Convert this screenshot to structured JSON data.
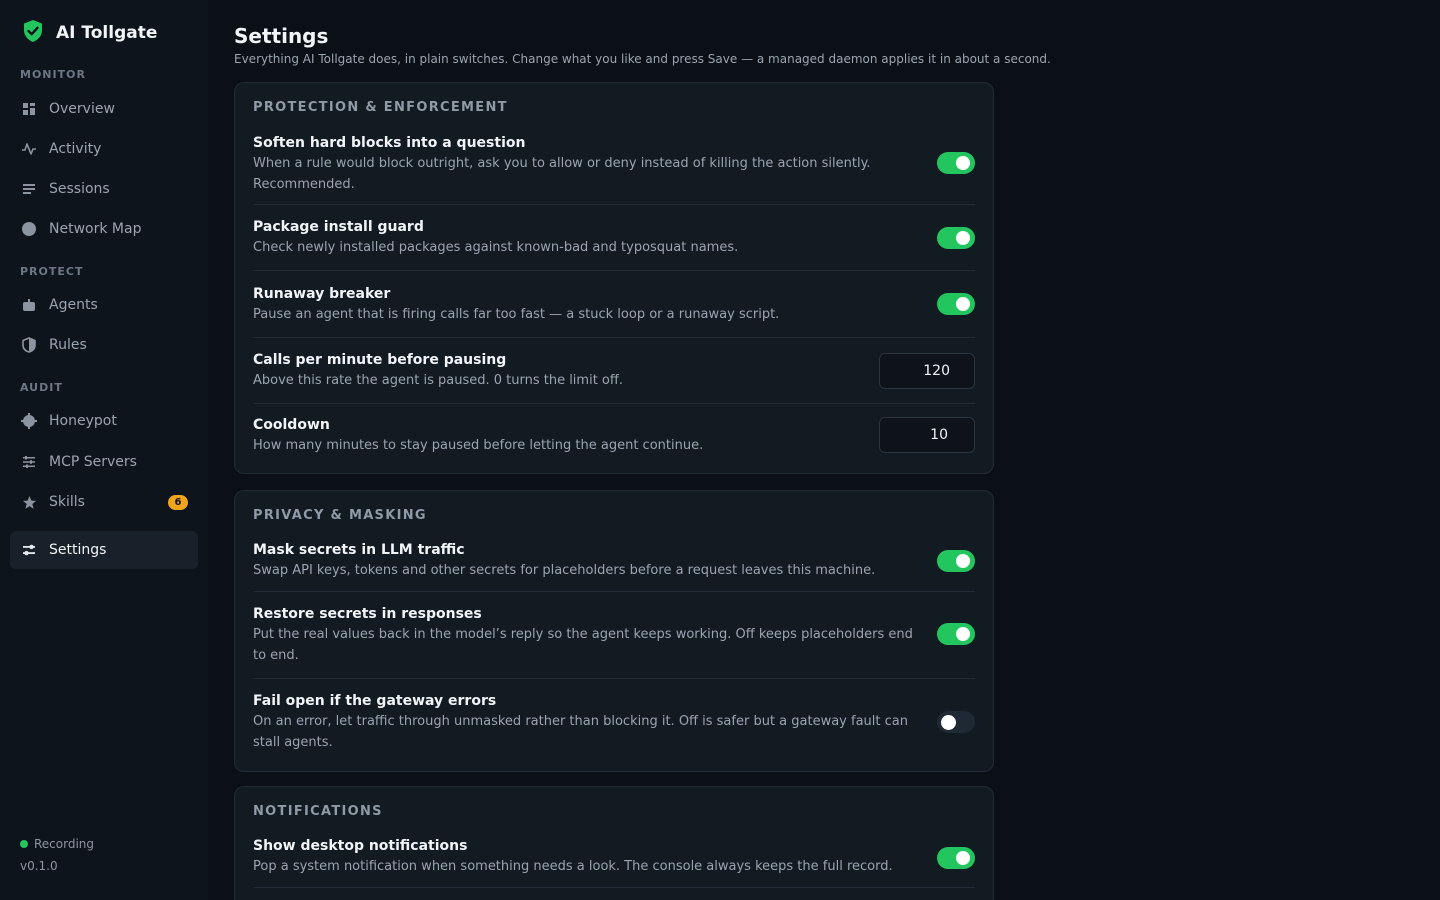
{
  "app": {
    "title": "AI Tollgate"
  },
  "sidebar": {
    "sections": {
      "monitor": "MONITOR",
      "protect": "PROTECT",
      "audit": "AUDIT"
    },
    "items": [
      {
        "label": "Overview",
        "icon": "grid-icon"
      },
      {
        "label": "Activity",
        "icon": "pulse-icon"
      },
      {
        "label": "Sessions",
        "icon": "list-icon"
      },
      {
        "label": "Network Map",
        "icon": "globe-icon"
      },
      {
        "label": "Agents",
        "icon": "robot-icon"
      },
      {
        "label": "Rules",
        "icon": "shield-icon"
      },
      {
        "label": "Honeypot",
        "icon": "bug-icon"
      },
      {
        "label": "MCP Servers",
        "icon": "sliders-icon"
      },
      {
        "label": "Skills",
        "icon": "star-icon",
        "badge": "6"
      },
      {
        "label": "Settings",
        "icon": "settings-icon",
        "active": true
      }
    ],
    "status": "Recording",
    "version": "v0.1.0"
  },
  "page": {
    "title": "Settings",
    "subtitle": "Everything AI Tollgate does, in plain switches. Change what you like and press Save — a managed daemon applies it in about a second."
  },
  "cards": [
    {
      "title": "PROTECTION & ENFORCEMENT",
      "rows": [
        {
          "title": "Soften hard blocks into a question",
          "desc": "When a rule would block outright, ask you to allow or deny instead of killing the action silently. Recommended.",
          "control": "toggle",
          "on": true
        },
        {
          "title": "Package install guard",
          "desc": "Check newly installed packages against known-bad and typosquat names.",
          "control": "toggle",
          "on": true
        },
        {
          "title": "Runaway breaker",
          "desc": "Pause an agent that is firing calls far too fast — a stuck loop or a runaway script.",
          "control": "toggle",
          "on": true
        },
        {
          "title": "Calls per minute before pausing",
          "desc": "Above this rate the agent is paused. 0 turns the limit off.",
          "control": "number",
          "value": "120"
        },
        {
          "title": "Cooldown",
          "desc": "How many minutes to stay paused before letting the agent continue.",
          "control": "number",
          "value": "10"
        }
      ]
    },
    {
      "title": "PRIVACY & MASKING",
      "rows": [
        {
          "title": "Mask secrets in LLM traffic",
          "desc": "Swap API keys, tokens and other secrets for placeholders before a request leaves this machine.",
          "control": "toggle",
          "on": true
        },
        {
          "title": "Restore secrets in responses",
          "desc": "Put the real values back in the model’s reply so the agent keeps working. Off keeps placeholders end to end.",
          "control": "toggle",
          "on": true
        },
        {
          "title": "Fail open if the gateway errors",
          "desc": "On an error, let traffic through unmasked rather than blocking it. Off is safer but a gateway fault can stall agents.",
          "control": "toggle",
          "on": false
        }
      ]
    },
    {
      "title": "NOTIFICATIONS",
      "rows": [
        {
          "title": "Show desktop notifications",
          "desc": "Pop a system notification when something needs a look. The console always keeps the full record.",
          "control": "toggle",
          "on": true
        }
      ]
    }
  ],
  "colors": {
    "accent": "#22c55e",
    "badge": "#f0a51c",
    "background": "#0b1016"
  }
}
